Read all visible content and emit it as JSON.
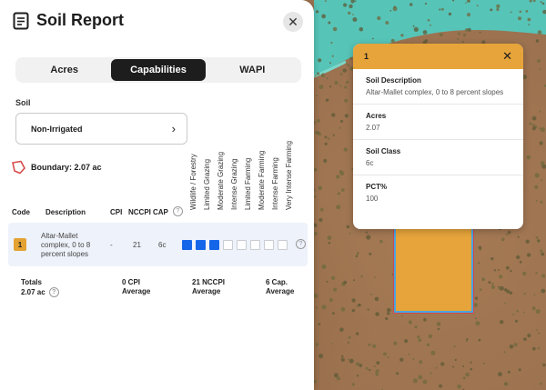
{
  "panel": {
    "title": "Soil Report",
    "tabs": [
      {
        "label": "Acres",
        "active": false
      },
      {
        "label": "Capabilities",
        "active": true
      },
      {
        "label": "WAPI",
        "active": false
      }
    ],
    "soil_label": "Soil",
    "soil_select_value": "Non-Irrigated",
    "boundary_text": "Boundary: 2.07 ac",
    "capability_headers": [
      "Wildlife / Forestry",
      "Limited Grazing",
      "Moderate Grazing",
      "Intense Grazing",
      "Limited Farming",
      "Moderate Farming",
      "Intense Farming",
      "Very Intense Farming"
    ],
    "columns": {
      "code": "Code",
      "description": "Description",
      "cpi": "CPI",
      "nccpi": "NCCPI",
      "cap": "CAP"
    },
    "rows": [
      {
        "code": "1",
        "description": "Altar-Mallet complex, 0 to 8 percent slopes",
        "cpi": "-",
        "nccpi": "21",
        "cap": "6c",
        "capability_level": 3
      }
    ],
    "totals": {
      "label": "Totals",
      "acres": "2.07 ac",
      "cpi": "0 CPI",
      "cpi_sub": "Average",
      "nccpi": "21 NCCPI",
      "nccpi_sub": "Average",
      "cap": "6 Cap.",
      "cap_sub": "Average"
    }
  },
  "popup": {
    "code": "1",
    "fields": [
      {
        "label": "Soil Description",
        "value": "Altar-Mallet complex, 0 to 8 percent slopes"
      },
      {
        "label": "Acres",
        "value": "2.07"
      },
      {
        "label": "Soil Class",
        "value": "6c"
      },
      {
        "label": "PCT%",
        "value": "100"
      }
    ]
  },
  "colors": {
    "accent": "#e6a43a",
    "tab_active": "#1d1d1d",
    "capability_fill": "#1565e8",
    "boundary": "#d84a4a",
    "water": "#57c4b8"
  },
  "icons": {
    "report": "report-icon",
    "close": "close-icon",
    "chevron": "chevron-right-icon",
    "boundary": "boundary-icon",
    "help": "help-icon"
  }
}
